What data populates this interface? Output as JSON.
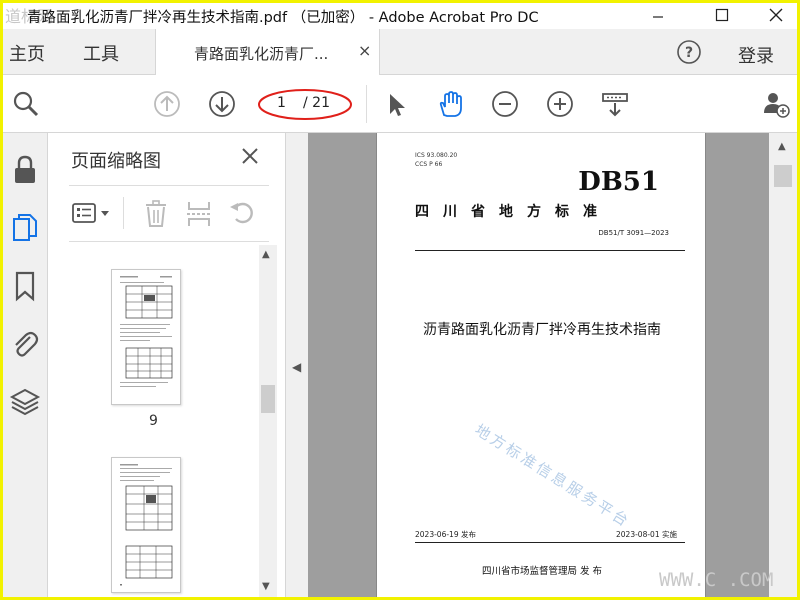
{
  "window": {
    "title": "青路面乳化沥青厂拌冷再生技术指南.pdf （已加密） - Adobe Acrobat Pro DC",
    "logo_text": "道标网",
    "controls": {
      "minimize": "—",
      "maximize": "☐",
      "close": "✕"
    }
  },
  "menu": {
    "home": "主页",
    "tools": "工具",
    "login": "登录"
  },
  "tab": {
    "label": "青路面乳化沥青厂...",
    "close": "×"
  },
  "toolbar": {
    "page_current": "1",
    "page_total": "/ 21",
    "icons": [
      "search-zoom-icon",
      "page-up-icon",
      "page-down-icon",
      "select-cursor-icon",
      "hand-tool-icon",
      "zoom-out-icon",
      "zoom-in-icon",
      "scroll-mode-icon",
      "add-user-icon"
    ]
  },
  "rail": {
    "icons": [
      "lock-icon",
      "page-thumbnails-icon",
      "bookmark-icon",
      "attachment-icon",
      "layers-icon"
    ]
  },
  "thumbnails": {
    "title": "页面缩略图",
    "close": "✕",
    "pages": [
      {
        "number": "9"
      },
      {
        "number": ""
      }
    ]
  },
  "document": {
    "ics": "ICS 93.080.20",
    "ccs": "CCS P 66",
    "db": "DB51",
    "province": "四川省地方标准",
    "std_no": "DB51/T 3091—2023",
    "title": "沥青路面乳化沥青厂拌冷再生技术指南",
    "watermark": "地方标准信息服务平台",
    "pub_date": "2023-06-19 发布",
    "impl_date": "2023-08-01 实施",
    "issuer": "四川省市场监督管理局   发 布"
  },
  "site_watermark": "WWW.C    .COM",
  "colors": {
    "accent": "#1473e6",
    "highlight_oval": "#e0201a",
    "frame": "#f2f200"
  }
}
